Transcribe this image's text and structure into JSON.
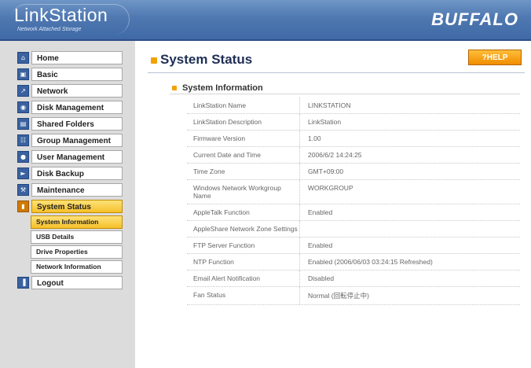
{
  "header": {
    "logo": "LinkStation",
    "logo_sub": "Network Attached Storage",
    "brand": "BUFFALO"
  },
  "sidebar": {
    "items": [
      {
        "label": "Home",
        "icon": "home-icon"
      },
      {
        "label": "Basic",
        "icon": "basic-icon"
      },
      {
        "label": "Network",
        "icon": "network-icon"
      },
      {
        "label": "Disk Management",
        "icon": "disk-icon"
      },
      {
        "label": "Shared Folders",
        "icon": "folder-icon"
      },
      {
        "label": "Group Management",
        "icon": "group-icon"
      },
      {
        "label": "User Management",
        "icon": "user-icon"
      },
      {
        "label": "Disk Backup",
        "icon": "backup-icon"
      },
      {
        "label": "Maintenance",
        "icon": "maintenance-icon"
      },
      {
        "label": "System Status",
        "icon": "status-icon"
      },
      {
        "label": "Logout",
        "icon": "logout-icon"
      }
    ],
    "subitems": [
      {
        "label": "System Information"
      },
      {
        "label": "USB Details"
      },
      {
        "label": "Drive Properties"
      },
      {
        "label": "Network Information"
      }
    ]
  },
  "main": {
    "page_title": "System Status",
    "help_label": "?HELP",
    "section_title": "System Information",
    "rows": [
      {
        "label": "LinkStation Name",
        "value": "LINKSTATION"
      },
      {
        "label": "LinkStation Description",
        "value": "LinkStation"
      },
      {
        "label": "Firmware Version",
        "value": "1.00"
      },
      {
        "label": "Current Date and Time",
        "value": "2006/6/2 14:24:25"
      },
      {
        "label": "Time Zone",
        "value": "GMT+09:00"
      },
      {
        "label": "Windows Network Workgroup Name",
        "value": "WORKGROUP"
      },
      {
        "label": "AppleTalk Function",
        "value": "Enabled"
      },
      {
        "label": "AppleShare Network Zone Settings",
        "value": ""
      },
      {
        "label": "FTP Server Function",
        "value": "Enabled"
      },
      {
        "label": "NTP Function",
        "value": "Enabled (2006/06/03 03:24:15 Refreshed)"
      },
      {
        "label": "Email Alert Notification",
        "value": "Disabled"
      },
      {
        "label": "Fan Status",
        "value": "Normal (回転停止中)"
      }
    ]
  }
}
